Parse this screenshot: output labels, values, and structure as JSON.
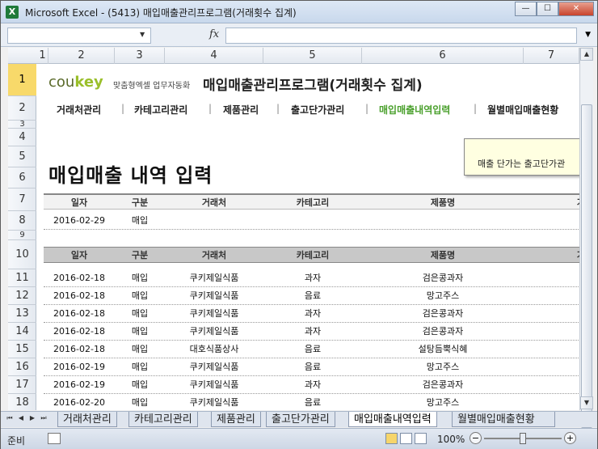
{
  "window": {
    "app_icon": "X",
    "title": "Microsoft Excel - (5413) 매입매출관리프로그램(거래횟수 집계)",
    "minimize_label": "—",
    "maximize_label": "☐",
    "close_label": "✕"
  },
  "formula_bar": {
    "name_box": "",
    "fx_label": "fx",
    "formula": ""
  },
  "columns": [
    "1",
    "2",
    "3",
    "4",
    "5",
    "6",
    "7"
  ],
  "rows": [
    "1",
    "2",
    "3",
    "4",
    "5",
    "6",
    "7",
    "8",
    "9",
    "10",
    "11",
    "12",
    "13",
    "14",
    "15",
    "16",
    "17",
    "18"
  ],
  "sheet": {
    "logo": "coukey",
    "logo_tagline": "맞춤형엑셀 업무자동화",
    "app_title": "매입매출관리프로그램(거래횟수 집계)",
    "menu": [
      "거래처관리",
      "카테고리관리",
      "제품관리",
      "출고단가관리",
      "매입매출내역입력",
      "월별매입매출현황"
    ],
    "menu_separator": "|",
    "active_menu": "매입매출내역입력",
    "heading": "매입매출 내역 입력",
    "note_mark": "※",
    "note_text": "매출 단가는  출고단가관",
    "table_headers": [
      "일자",
      "구분",
      "거래처",
      "카테고리",
      "제품명",
      "거"
    ],
    "input_row": [
      "2016-02-29",
      "매입",
      "",
      "",
      ""
    ],
    "records": [
      [
        "2016-02-18",
        "매입",
        "쿠키제일식품",
        "과자",
        "검은콩과자"
      ],
      [
        "2016-02-18",
        "매입",
        "쿠키제일식품",
        "음료",
        "망고주스"
      ],
      [
        "2016-02-18",
        "매입",
        "쿠키제일식품",
        "과자",
        "검은콩과자"
      ],
      [
        "2016-02-18",
        "매입",
        "쿠키제일식품",
        "과자",
        "검은콩과자"
      ],
      [
        "2016-02-18",
        "매입",
        "대호식품상사",
        "음료",
        "설탕듬뿍식혜"
      ],
      [
        "2016-02-19",
        "매입",
        "쿠키제일식품",
        "음료",
        "망고주스"
      ],
      [
        "2016-02-19",
        "매입",
        "쿠키제일식품",
        "과자",
        "검은콩과자"
      ],
      [
        "2016-02-20",
        "매입",
        "쿠키제일식품",
        "음료",
        "망고주스"
      ]
    ]
  },
  "sheet_tabs": [
    "거래처관리",
    "카테고리관리",
    "제품관리",
    "출고단가관리",
    "매입매출내역입력",
    "월별매입매출현황"
  ],
  "active_tab": "매입매출내역입력",
  "status": {
    "ready": "준비",
    "zoom": "100%",
    "zoom_minus": "−",
    "zoom_plus": "+"
  }
}
